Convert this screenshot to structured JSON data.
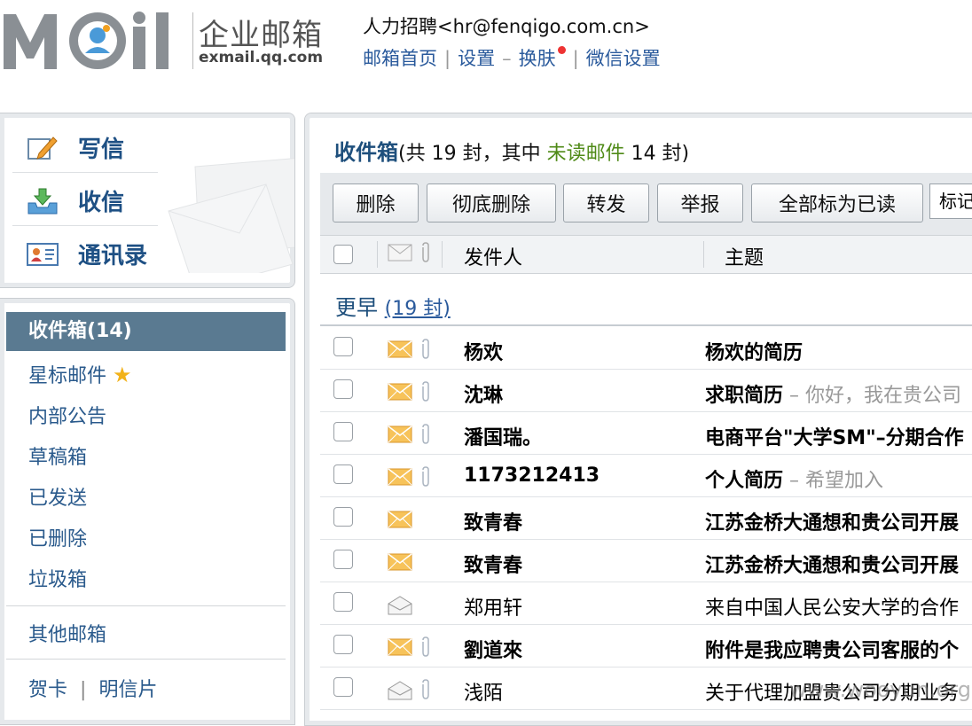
{
  "header": {
    "brand_cn": "企业邮箱",
    "brand_en": "exmail.qq.com",
    "account": "人力招聘<hr@fenqigo.com.cn>",
    "links": [
      "邮箱首页",
      "设置",
      "换肤",
      "微信设置"
    ],
    "link_seps": [
      "|",
      "–",
      "|"
    ]
  },
  "nav": {
    "write": "写信",
    "receive": "收信",
    "contacts": "通讯录"
  },
  "folders": {
    "inbox": "收件箱(14)",
    "starred": "星标邮件",
    "notice": "内部公告",
    "drafts": "草稿箱",
    "sent": "已发送",
    "deleted": "已删除",
    "spam": "垃圾箱",
    "other": "其他邮箱",
    "card": "贺卡",
    "card_sep": "|",
    "postcard": "明信片"
  },
  "inbox": {
    "title": "收件箱",
    "summary_a": "(共 19 封，其中 ",
    "unread_label": "未读邮件",
    "summary_b": " 14 封)"
  },
  "toolbar": {
    "delete": "删除",
    "purge": "彻底删除",
    "forward": "转发",
    "report": "举报",
    "mark_all_read": "全部标为已读",
    "mark_as": "标记"
  },
  "table": {
    "col_sender": "发件人",
    "col_subject": "主题",
    "group_label": "更早",
    "group_count": "(19 封)"
  },
  "rows": [
    {
      "sender": "杨欢",
      "subject": "杨欢的简历",
      "preview": "",
      "unread": true,
      "attach": true
    },
    {
      "sender": "沈琳",
      "subject": "求职简历",
      "preview": " – 你好，我在贵公司",
      "unread": true,
      "attach": true
    },
    {
      "sender": "潘国瑞。",
      "subject": "电商平台\"大学SM\"–分期合作",
      "preview": "",
      "unread": true,
      "attach": true
    },
    {
      "sender": "1173212413",
      "subject": "个人简历",
      "preview": " – 希望加入",
      "unread": true,
      "attach": true
    },
    {
      "sender": "致青春",
      "subject": "江苏金桥大通想和贵公司开展",
      "preview": "",
      "unread": true,
      "attach": false
    },
    {
      "sender": "致青春",
      "subject": "江苏金桥大通想和贵公司开展",
      "preview": "",
      "unread": true,
      "attach": false
    },
    {
      "sender": "郑用轩",
      "subject": "来自中国人民公安大学的合作",
      "preview": "",
      "unread": false,
      "attach": false
    },
    {
      "sender": "劉道來",
      "subject": "附件是我应聘贵公司客服的个",
      "preview": "",
      "unread": true,
      "attach": true
    },
    {
      "sender": "浅陌",
      "subject": "关于代理加盟贵公司分期业务",
      "preview": "",
      "unread": false,
      "attach": true
    }
  ],
  "watermark": "www.wooyun.org",
  "colors": {
    "accent": "#1e4f7c",
    "unread_green": "#4f8a17",
    "active_folder": "#5a7a91",
    "link": "#2a5a9c"
  }
}
